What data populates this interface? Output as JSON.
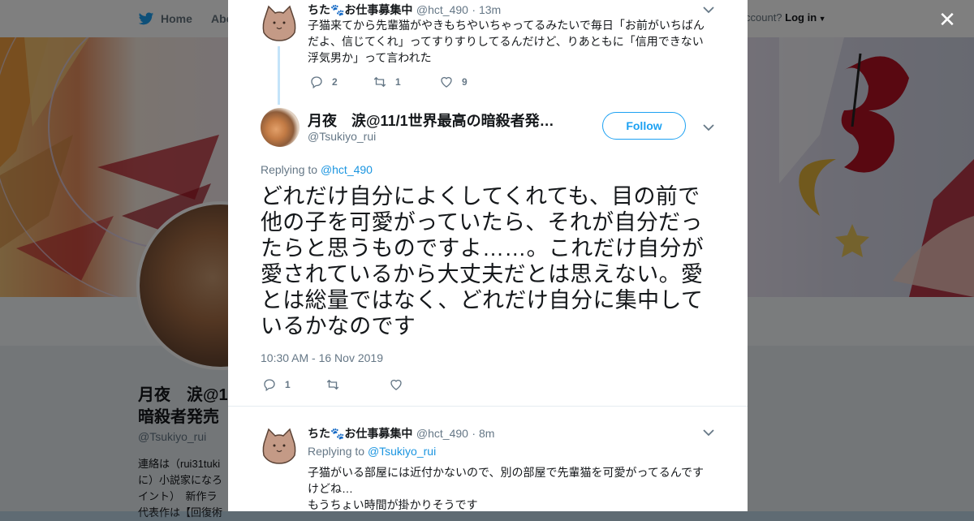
{
  "background": {
    "nav_home": "Home",
    "nav_about": "Abo",
    "login_prompt": "ccount?",
    "login_label": "Log in",
    "name_line1": "月夜　涙@1",
    "name_line2": "暗殺者発売",
    "handle": "@Tsukiyo_rui",
    "bio_line1": "連絡は（rui31tuki",
    "bio_line2": "に）小説家になろ",
    "bio_line3": "イント）　新作ラ",
    "bio_line4": "代表作は【回復術"
  },
  "close_label": "✕",
  "reply1": {
    "name": "ちた🐾お仕事募集中",
    "handle": "@hct_490",
    "time": "· 13m",
    "text_line1": "子猫来てから先輩猫がやきもちやいちゃってるみたいで毎日「お前がいちばん",
    "text_line2": "だよ、信じてくれ」ってすりすりしてるんだけど、りあともに「信用できない",
    "text_line3": "浮気男か」って言われた",
    "replies": "2",
    "retweets": "1",
    "likes": "9"
  },
  "main_tweet": {
    "name": "月夜　涙@11/1世界最高の暗殺者発…",
    "handle": "@Tsukiyo_rui",
    "follow_label": "Follow",
    "replying_to_prefix": "Replying to",
    "replying_to_handle": "@hct_490",
    "text": "どれだけ自分によくしてくれても、目の前で他の子を可愛がっていたら、それが自分だったらと思うものですよ……。これだけ自分が愛されているから大丈夫だとは思えない。愛とは総量ではなく、どれだけ自分に集中しているかなのです",
    "timestamp": "10:30 AM - 16 Nov 2019",
    "replies": "1"
  },
  "reply2": {
    "name": "ちた🐾お仕事募集中",
    "handle": "@hct_490",
    "time": "· 8m",
    "replying_to_prefix": "Replying to",
    "replying_to_handle": "@Tsukiyo_rui",
    "text_line1": "子猫がいる部屋には近付かないので、別の部屋で先輩猫を可愛がってるんです",
    "text_line2": "けどね…",
    "text_line3": "もうちょい時間が掛かりそうです"
  },
  "colors": {
    "link": "#1b95e0",
    "accent": "#1da1f2",
    "thread_line": "#c4e4f9",
    "text": "#14171a",
    "muted": "#657786"
  },
  "icons": [
    "twitter-bird-icon",
    "reply-icon",
    "retweet-icon",
    "like-icon",
    "chevron-down-icon",
    "close-icon"
  ]
}
